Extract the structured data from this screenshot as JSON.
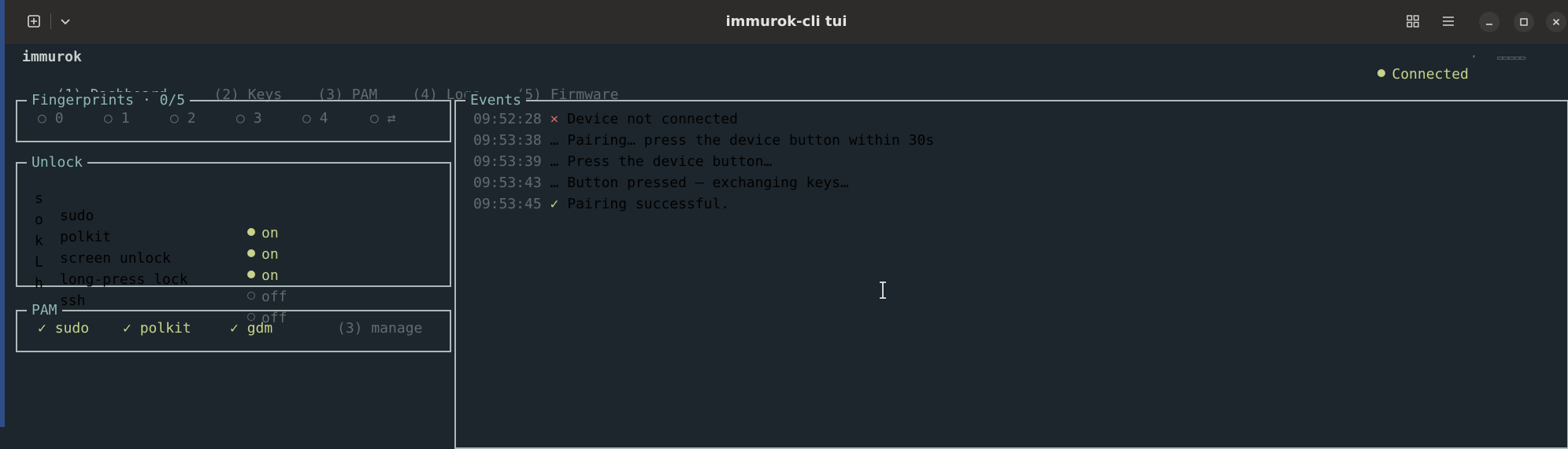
{
  "window": {
    "title": "immurok-cli tui",
    "icons": [
      "new-tab-icon",
      "chevron-down-icon",
      "grid-icon",
      "hamburger-menu-icon",
      "minimize-icon",
      "maximize-icon",
      "close-icon"
    ]
  },
  "app": {
    "name": "immurok",
    "status": "Connected",
    "status_color": "#c7d38a",
    "separator": "·",
    "battery_glyph": "▭▭▭▭▭"
  },
  "tabs": [
    {
      "key": "(1)",
      "label": "Dashboard",
      "active": true
    },
    {
      "key": "(2)",
      "label": "Keys",
      "active": false
    },
    {
      "key": "(3)",
      "label": "PAM",
      "active": false
    },
    {
      "key": "(4)",
      "label": "Logs",
      "active": false
    },
    {
      "key": "(5)",
      "label": "Firmware",
      "active": false
    }
  ],
  "fingerprints": {
    "title": "Fingerprints",
    "count": "0/5",
    "slots": [
      "0",
      "1",
      "2",
      "3",
      "4"
    ],
    "swap_glyph": "⇄"
  },
  "unlock": {
    "title": "Unlock",
    "items": [
      {
        "key": "s",
        "label": "sudo",
        "state": "on"
      },
      {
        "key": "o",
        "label": "polkit",
        "state": "on"
      },
      {
        "key": "k",
        "label": "screen unlock",
        "state": "on"
      },
      {
        "key": "L",
        "label": "long-press lock",
        "state": "off"
      },
      {
        "key": "h",
        "label": "ssh",
        "state": "off"
      }
    ]
  },
  "pam": {
    "title": "PAM",
    "items": [
      "sudo",
      "polkit",
      "gdm"
    ],
    "check_glyph": "✓",
    "manage": "(3) manage"
  },
  "events": {
    "title": "Events",
    "items": [
      {
        "time": "09:52:28",
        "glyph": "×",
        "text": "Device not connected"
      },
      {
        "time": "09:53:38",
        "glyph": "…",
        "text": "Pairing… press the device button within 30s"
      },
      {
        "time": "09:53:39",
        "glyph": "…",
        "text": "Press the device button…"
      },
      {
        "time": "09:53:43",
        "glyph": "…",
        "text": "Button pressed — exchanging keys…"
      },
      {
        "time": "09:53:45",
        "glyph": "✓",
        "text": "Pairing successful."
      }
    ]
  }
}
